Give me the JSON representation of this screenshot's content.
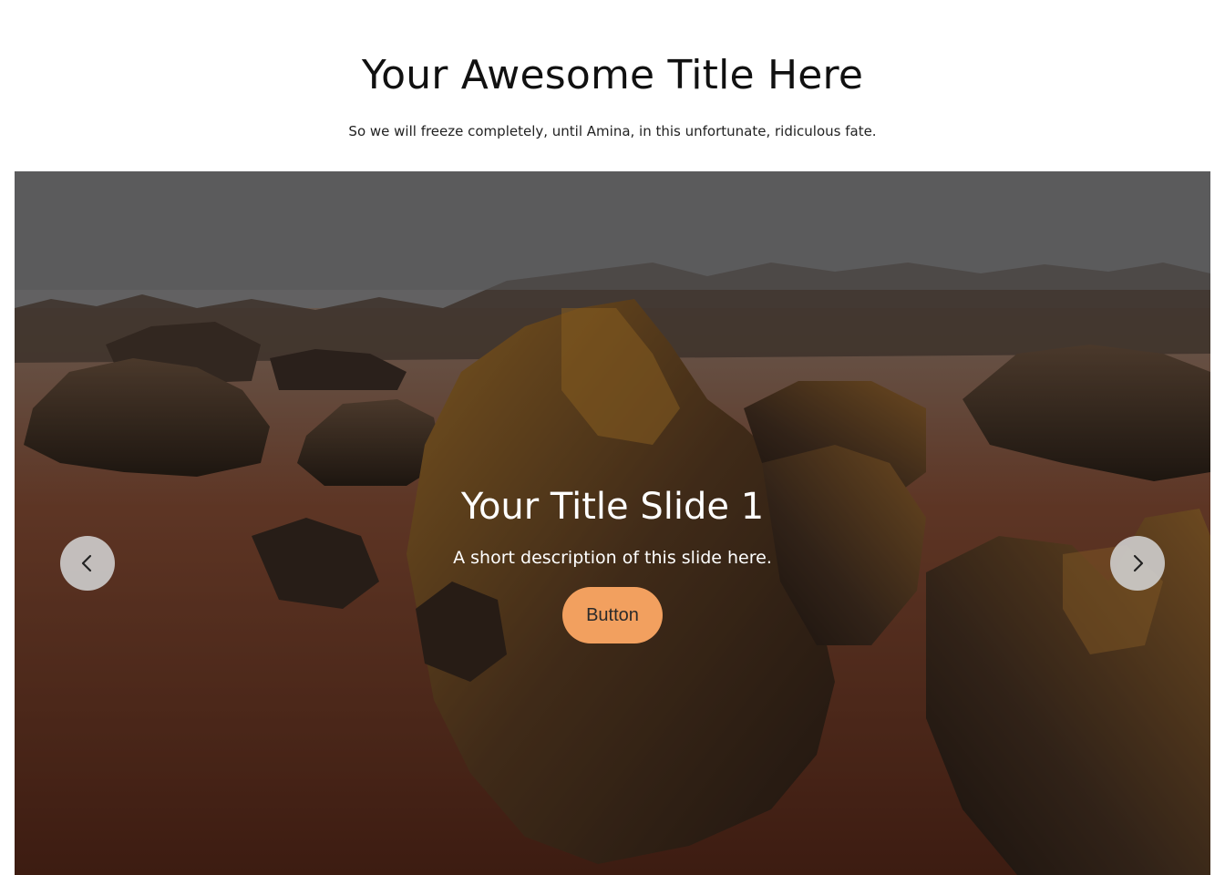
{
  "header": {
    "title": "Your Awesome Title Here",
    "subtitle": "So we will freeze completely, until Amina, in this unfortunate, ridiculous fate."
  },
  "slider": {
    "current_slide": 1,
    "slides": [
      {
        "title": "Your Title Slide 1",
        "description": "A short description of this slide here.",
        "button_label": "Button"
      }
    ],
    "prev_icon": "chevron-left-icon",
    "next_icon": "chevron-right-icon"
  },
  "colors": {
    "button_bg": "#f2a05f",
    "nav_bg": "#d2d2d2",
    "text_dark": "#111111",
    "text_light": "#ffffff"
  }
}
